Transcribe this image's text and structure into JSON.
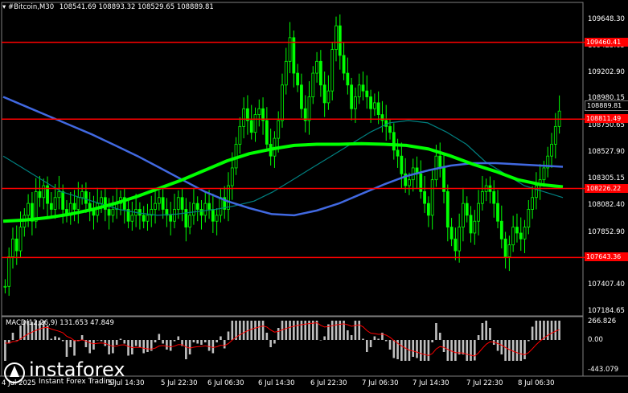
{
  "header": {
    "symbol": "#Bitcoin,M30",
    "ohlc": "108541.69 108893.32 108529.65 108889.81"
  },
  "price_axis": {
    "ticks": [
      "109648.30",
      "109425.65",
      "109202.90",
      "108980.15",
      "108750.65",
      "108527.90",
      "108305.15",
      "108082.40",
      "107852.90",
      "107630.15",
      "107407.40",
      "107184.65"
    ],
    "current_price": "108889.81"
  },
  "levels": [
    {
      "label": "109460.41",
      "value": 109460.41,
      "color": "#ff0000"
    },
    {
      "label": "108811.49",
      "value": 108811.49,
      "color": "#ff0000"
    },
    {
      "label": "108226.22",
      "value": 108226.22,
      "color": "#ff0000"
    },
    {
      "label": "107643.36",
      "value": 107643.36,
      "color": "#ff0000"
    }
  ],
  "time_axis": [
    "4 Jul 2025",
    "5 Jul 14:30",
    "5 Jul 22:30",
    "6 Jul 06:30",
    "6 Jul 14:30",
    "6 Jul 22:30",
    "7 Jul 06:30",
    "7 Jul 14:30",
    "7 Jul 22:30",
    "8 Jul 06:30"
  ],
  "macd": {
    "label": "MACD(12,26,9) 131.653 47.849",
    "ticks": [
      "266.826",
      "0.00",
      "-443.079"
    ]
  },
  "watermark": {
    "brand": "instaforex",
    "tagline": "Instant Forex Trading"
  },
  "colors": {
    "candles": "#00ff00",
    "ma_fast": "#008080",
    "ma_mid": "#00ff00",
    "ma_slow": "#4169e1",
    "levels": "#ff0000",
    "macd_hist": "#c0c0c0",
    "macd_signal": "#ff0000"
  },
  "chart_data": {
    "type": "candlestick",
    "title": "#Bitcoin,M30",
    "ylim": [
      107184.65,
      109700
    ],
    "close_path": [
      107400,
      107650,
      107800,
      107700,
      107900,
      108000,
      108100,
      107950,
      108200,
      108150,
      108250,
      108100,
      108050,
      108150,
      108200,
      108050,
      108000,
      108100,
      108050,
      108150,
      108200,
      108100,
      108050,
      108000,
      108100,
      108150,
      108050,
      108000,
      108050,
      108100,
      108150,
      108050,
      107950,
      108000,
      108050,
      108000,
      107950,
      108000,
      108050,
      108100,
      108150,
      108050,
      108000,
      107950,
      108050,
      108150,
      108050,
      107900,
      108000,
      108100,
      108050,
      108000,
      108100,
      108050,
      107950,
      108000,
      108150,
      108050,
      108250,
      108400,
      108600,
      108750,
      108900,
      108800,
      108700,
      108850,
      108900,
      108800,
      108600,
      108500,
      108650,
      108800,
      109100,
      109300,
      109500,
      109200,
      109100,
      108900,
      108800,
      109000,
      109200,
      109300,
      109100,
      108950,
      109050,
      109400,
      109600,
      109350,
      109200,
      109100,
      108900,
      109000,
      109100,
      109050,
      109000,
      108900,
      108950,
      108850,
      108800,
      108750,
      108700,
      108550,
      108500,
      108350,
      108250,
      108300,
      108400,
      108350,
      108200,
      108100,
      108000,
      108300,
      108500,
      108400,
      108200,
      107900,
      107800,
      107700,
      107900,
      108100,
      108000,
      107850,
      107950,
      108100,
      108200,
      108250,
      108200,
      108100,
      107950,
      107800,
      107650,
      107750,
      107900,
      107850,
      107800,
      107900,
      108050,
      108150,
      108250,
      108300,
      108400,
      108500,
      108600,
      108750,
      108880
    ],
    "ma_fast": [
      108500,
      108400,
      108300,
      108200,
      108150,
      108100,
      108050,
      108020,
      108000,
      108010,
      108030,
      108050,
      108080,
      108120,
      108200,
      108300,
      108400,
      108500,
      108600,
      108700,
      108780,
      108800,
      108780,
      108700,
      108600,
      108450,
      108350,
      108250,
      108200,
      108150
    ],
    "ma_mid": [
      107950,
      107960,
      107980,
      108010,
      108050,
      108100,
      108160,
      108230,
      108300,
      108380,
      108460,
      108520,
      108560,
      108590,
      108600,
      108600,
      108605,
      108600,
      108590,
      108560,
      108500,
      108430,
      108370,
      108300,
      108260,
      108240
    ],
    "ma_slow": [
      109000,
      108920,
      108840,
      108760,
      108680,
      108590,
      108500,
      108400,
      108300,
      108200,
      108120,
      108060,
      108010,
      108000,
      108040,
      108100,
      108180,
      108260,
      108330,
      108380,
      108420,
      108440,
      108440,
      108430,
      108420,
      108410
    ]
  }
}
